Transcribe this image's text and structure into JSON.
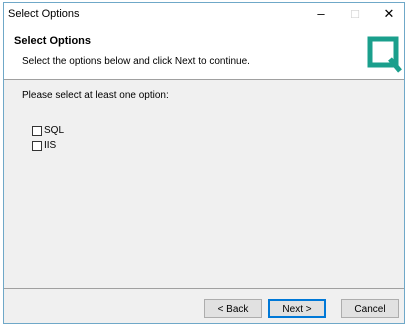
{
  "window": {
    "title": "Select Options",
    "controls": {
      "minimize": "–",
      "maximize": "□",
      "close": "✕"
    }
  },
  "header": {
    "title": "Select Options",
    "description": "Select the options below and click Next to continue.",
    "logo_icon": "q-logo-icon",
    "logo_color": "#1a9f8c"
  },
  "main": {
    "prompt": "Please select at least one option:",
    "options": [
      {
        "label": "SQL",
        "checked": false
      },
      {
        "label": "IIS",
        "checked": false
      }
    ]
  },
  "footer": {
    "back_label": "< Back",
    "next_label": "Next >",
    "cancel_label": "Cancel"
  }
}
